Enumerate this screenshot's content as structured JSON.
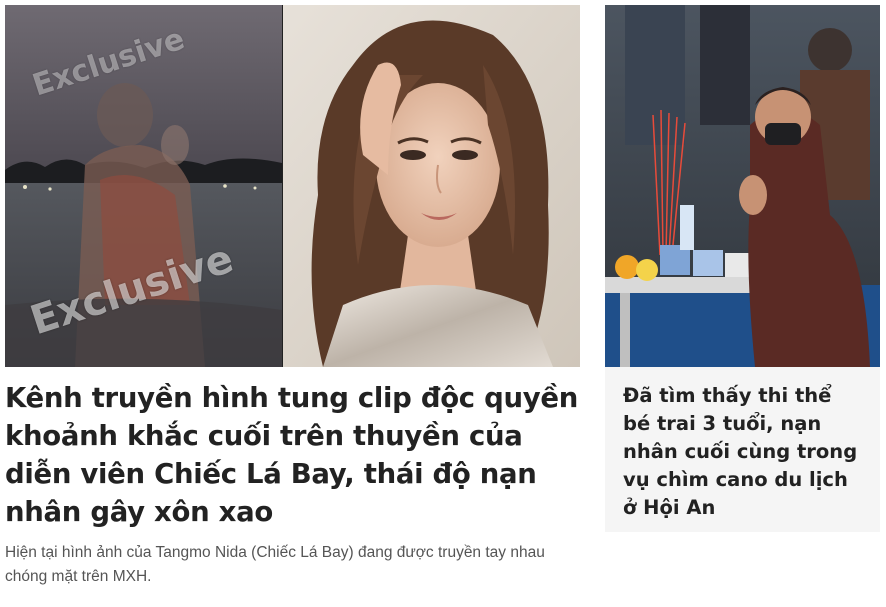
{
  "main_story": {
    "title": "Kênh truyền hình tung clip độc quyền khoảnh khắc cuối trên thuyền của diễn viên Chiếc Lá Bay, thái độ nạn nhân gây xôn xao",
    "summary": "Hiện tại hình ảnh của Tangmo Nida (Chiếc Lá Bay) đang được truyền tay nhau chóng mặt trên MXH.",
    "image_watermark_1": "Exclusive",
    "image_watermark_2": "Exclusive"
  },
  "side_story": {
    "title": "Đã tìm thấy thi thể bé trai 3 tuổi, nạn nhân cuối cùng trong vụ chìm cano du lịch ở Hội An"
  }
}
